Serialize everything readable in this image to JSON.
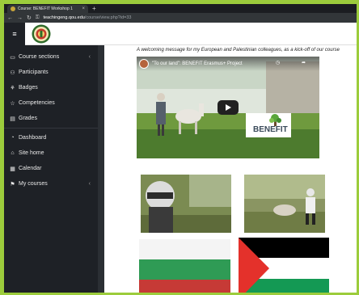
{
  "browser": {
    "tab_title": "Course: BENEFIT Workshop 1",
    "tab_close": "×",
    "new_tab": "+",
    "url_host": "teachingeng.qou.edu",
    "url_path": "/course/view.php?id=33"
  },
  "sidebar": {
    "items": [
      {
        "label": "Course sections",
        "icon": "folder-icon",
        "glyph": "▭",
        "chevron": "‹"
      },
      {
        "label": "Participants",
        "icon": "users-icon",
        "glyph": "⚇"
      },
      {
        "label": "Badges",
        "icon": "badge-icon",
        "glyph": "⚘"
      },
      {
        "label": "Competencies",
        "icon": "competencies-icon",
        "glyph": "☆"
      },
      {
        "label": "Grades",
        "icon": "grades-icon",
        "glyph": "▤"
      }
    ],
    "items2": [
      {
        "label": "Dashboard",
        "icon": "dashboard-icon",
        "glyph": "◔"
      },
      {
        "label": "Site home",
        "icon": "home-icon",
        "glyph": "⌂"
      },
      {
        "label": "Calendar",
        "icon": "calendar-icon",
        "glyph": "▦"
      },
      {
        "label": "My courses",
        "icon": "courses-icon",
        "glyph": "⚑",
        "chevron": "‹"
      }
    ]
  },
  "content": {
    "intro": "A welcoming message for my European and Palestinian colleagues, as a kick-off of our course",
    "video_title": "\"To our land\": BENEFIT Erasmus+ Project",
    "benefit_logo_text": "BENEFIT"
  },
  "colors": {
    "page_border": "#9ccc3c",
    "sidebar_bg": "#1e2126",
    "bulgaria": [
      "#ffffff",
      "#00966e",
      "#d62612"
    ],
    "palestine": [
      "#000000",
      "#ffffff",
      "#149954",
      "#e4312b"
    ]
  }
}
